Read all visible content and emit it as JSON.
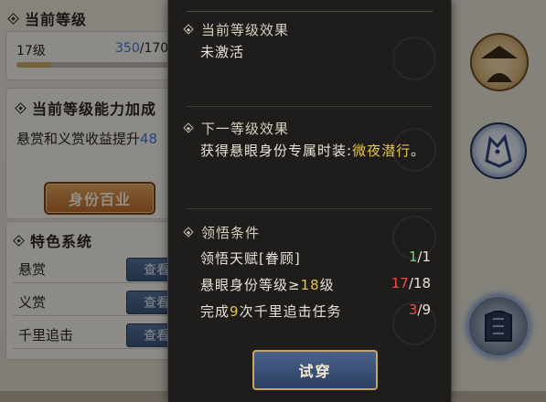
{
  "left": {
    "current_level_title": "当前等级",
    "level_label": "17级",
    "level_progress_current": "350",
    "level_progress_sep_max": "/170",
    "progress_fraction": 0.21,
    "ability_title": "当前等级能力加成",
    "ability_text": "悬赏和义赏收益提升",
    "ability_value": "48",
    "identity_book_button": "身份百业",
    "feature_title": "特色系统",
    "features": [
      {
        "label": "悬赏",
        "button": "查看"
      },
      {
        "label": "义赏",
        "button": "查看"
      },
      {
        "label": "千里追击",
        "button": "查看"
      }
    ]
  },
  "popup": {
    "current_effect_title": "当前等级效果",
    "current_effect_text": "未激活",
    "next_effect_title": "下一等级效果",
    "next_effect_prefix": "获得悬眼身份专属时装:",
    "next_effect_item": "微夜潜行",
    "next_effect_suffix": "。",
    "condition_title": "领悟条件",
    "conditions": [
      {
        "text_a": "领悟天赋[眷顾]",
        "text_hl": "",
        "text_b": "",
        "val_cur": "1",
        "val_max": "/1",
        "cur_color": "green"
      },
      {
        "text_a": "悬眼身份等级≥",
        "text_hl": "18",
        "text_b": "级",
        "val_cur": "17",
        "val_max": "/18",
        "cur_color": "red"
      },
      {
        "text_a": "完成",
        "text_hl": "9",
        "text_b": "次千里追击任务",
        "val_cur": "3",
        "val_max": "/9",
        "cur_color": "red"
      }
    ],
    "try_button": "试穿"
  },
  "colors": {
    "accent_gold": "#c9a765",
    "highlight_yellow": "#e8c34a",
    "done_green": "#7dd27a",
    "lack_red": "#ef4b4b",
    "button_blue": "#3a5579"
  },
  "icons": [
    "straw-hat-portrait-medal",
    "wolf-emblem-medal",
    "armor-outfit-medal"
  ]
}
